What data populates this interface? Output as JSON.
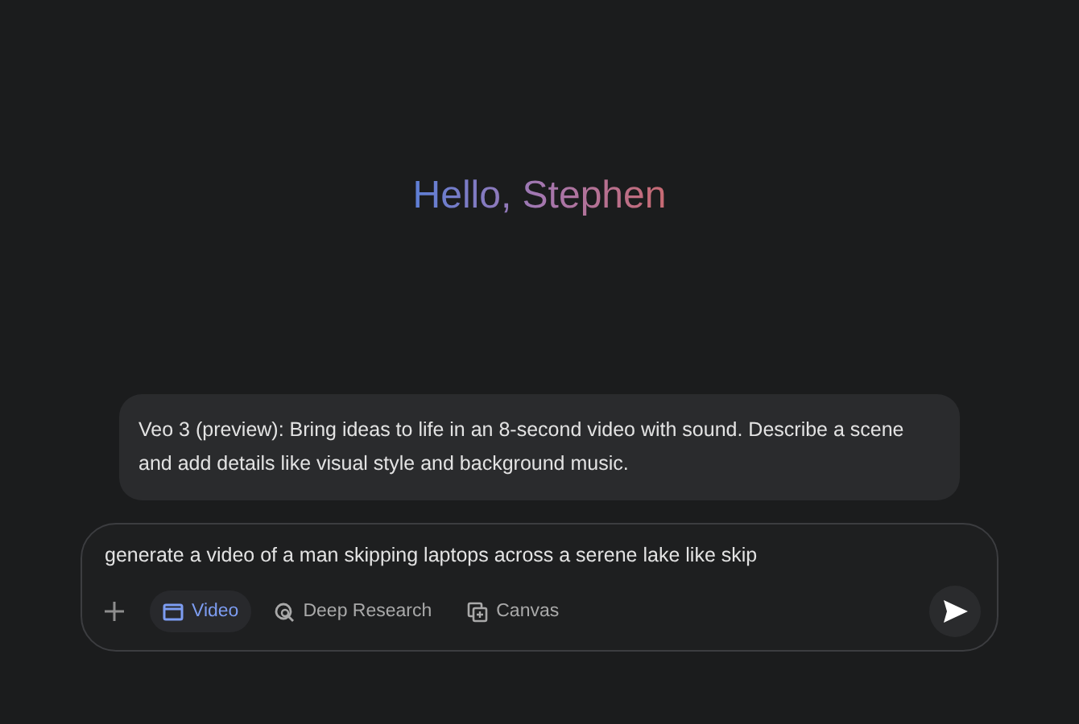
{
  "greeting": "Hello, Stephen",
  "info_card": {
    "text": "Veo 3 (preview): Bring ideas to life in an 8-second video with sound. Describe a scene and add details like visual style and background music."
  },
  "prompt": {
    "value": "generate a video of a man skipping laptops across a serene lake like skip"
  },
  "tools": [
    {
      "kind": "video",
      "label": "Video",
      "selected": true
    },
    {
      "kind": "research",
      "label": "Deep Research",
      "selected": false
    },
    {
      "kind": "canvas",
      "label": "Canvas",
      "selected": false
    }
  ]
}
